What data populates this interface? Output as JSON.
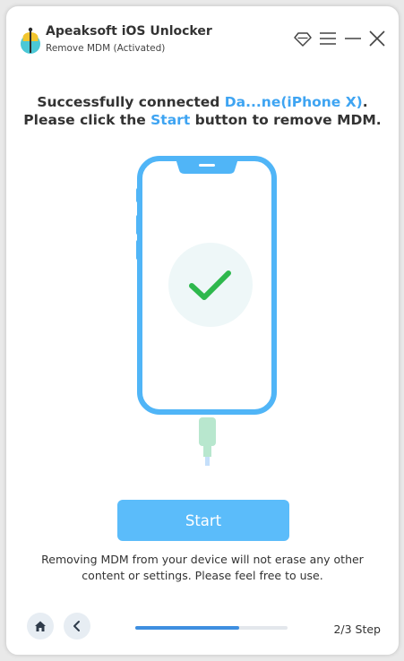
{
  "app": {
    "title": "Apeaksoft iOS Unlocker",
    "subtitle": "Remove MDM  (Activated)"
  },
  "colors": {
    "accent": "#3ea4f2",
    "button": "#5bbcfa",
    "phone_outline": "#50b5f7",
    "check": "#2eb84d",
    "progress": "#3e8fe0"
  },
  "icons": {
    "logo": "apeaksoft-logo-icon",
    "diamond": "diamond-icon",
    "menu": "menu-icon",
    "minimize": "minimize-icon",
    "close": "close-icon",
    "check": "checkmark-icon",
    "home": "home-icon",
    "back": "chevron-left-icon"
  },
  "headline": {
    "line1_prefix": "Successfully connected ",
    "device_name": "Da...ne(iPhone X)",
    "line1_suffix": ".",
    "line2_prefix": "Please click the ",
    "start_word": "Start",
    "line2_suffix": " button to remove MDM."
  },
  "start_button": {
    "label": "Start"
  },
  "note": "Removing MDM from your device will not erase any other content or settings. Please feel free to use.",
  "footer": {
    "progress": 0.68,
    "step_label": "2/3 Step"
  }
}
